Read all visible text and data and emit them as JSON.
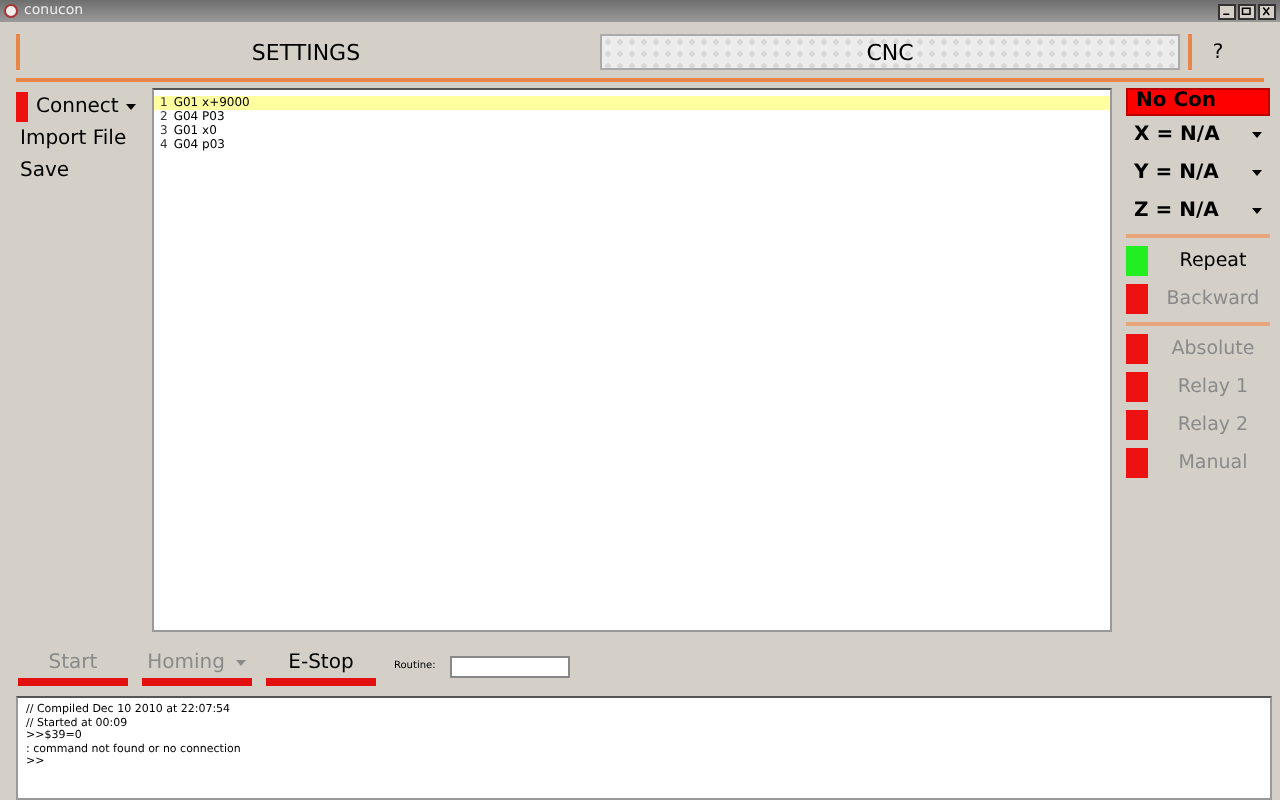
{
  "window": {
    "title": "conucon"
  },
  "tabs": [
    {
      "label": "SETTINGS",
      "selected": false
    },
    {
      "label": "CNC",
      "selected": true
    }
  ],
  "help": "?",
  "menu": [
    {
      "label": "Connect",
      "kind": "dropdown",
      "color": "#ee1111"
    },
    {
      "label": "Import File",
      "kind": "plain"
    },
    {
      "label": "Save",
      "kind": "plain"
    }
  ],
  "editor": {
    "lines": [
      {
        "number": "1",
        "text": "G01 x+9000",
        "selected": true
      },
      {
        "number": "2",
        "text": "G04 P03",
        "selected": false
      },
      {
        "number": "3",
        "text": "G01 x0",
        "selected": false
      },
      {
        "number": "4",
        "text": "G04 p03",
        "selected": false
      }
    ]
  },
  "status": {
    "label": "No Con",
    "color": "#ff0000"
  },
  "axes": [
    {
      "label": "X = N/A"
    },
    {
      "label": "Y = N/A"
    },
    {
      "label": "Z = N/A"
    }
  ],
  "toggle_groups": [
    [
      {
        "label": "Repeat",
        "color": "#22ee22",
        "disabled": false
      },
      {
        "label": "Backward",
        "color": "#ee1111",
        "disabled": true
      }
    ],
    [
      {
        "label": "Absolute",
        "color": "#ee1111",
        "disabled": true
      },
      {
        "label": "Relay 1",
        "color": "#ee1111",
        "disabled": true
      },
      {
        "label": "Relay 2",
        "color": "#ee1111",
        "disabled": true
      },
      {
        "label": "Manual",
        "color": "#ee1111",
        "disabled": true
      }
    ]
  ],
  "actions": [
    {
      "label": "Start",
      "disabled": true,
      "kind": "plain"
    },
    {
      "label": "Homing",
      "disabled": true,
      "kind": "dropdown"
    },
    {
      "label": "E-Stop",
      "disabled": false,
      "kind": "plain"
    }
  ],
  "routine": {
    "label": "Routine:"
  },
  "console": [
    "// Compiled Dec 10 2010 at 22:07:54",
    "// Started at 00:09",
    ">>$39=0",
    ": command not found or no connection",
    ">>"
  ]
}
